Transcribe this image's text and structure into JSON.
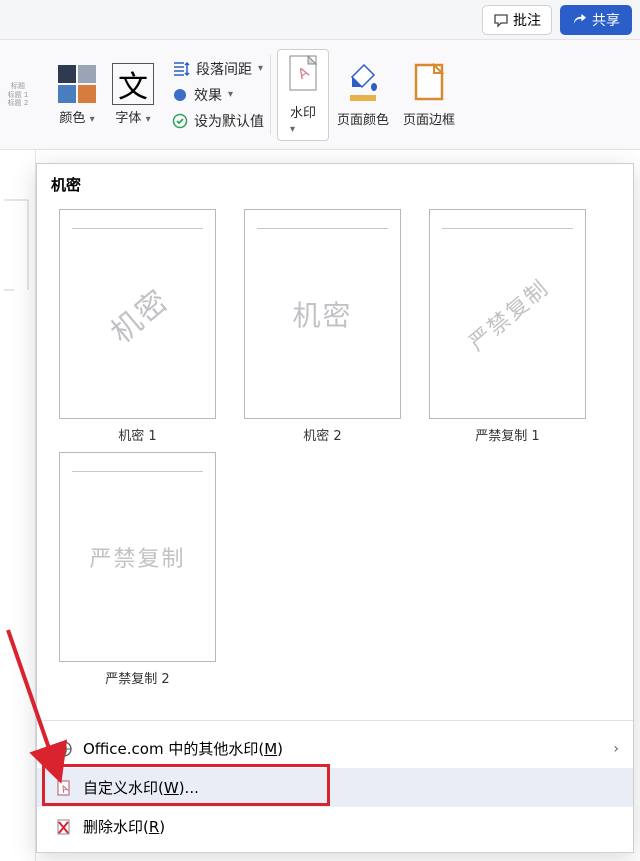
{
  "topbar": {
    "comment": "批注",
    "share": "共享"
  },
  "ribbon": {
    "color": "颜色",
    "font": "字体",
    "font_char": "文",
    "paragraph_spacing": "段落间距",
    "effects": "效果",
    "set_default": "设为默认值",
    "watermark": "水印",
    "page_color": "页面颜色",
    "page_border": "页面边框"
  },
  "dropdown": {
    "section": "机密",
    "thumbs": [
      {
        "wm": "机密",
        "label": "机密 1",
        "cls": "wm-diag"
      },
      {
        "wm": "机密",
        "label": "机密 2",
        "cls": "wm-horz"
      },
      {
        "wm": "严禁复制",
        "label": "严禁复制 1",
        "cls": "wm-diag wm-long"
      },
      {
        "wm": "严禁复制",
        "label": "严禁复制 2",
        "cls": "wm-horz wm-long"
      }
    ],
    "menu": {
      "office_more_pre": "Office.com 中的其他水印(",
      "office_more_key": "M",
      "office_more_post": ")",
      "custom_pre": "自定义水印(",
      "custom_key": "W",
      "custom_post": ")...",
      "remove_pre": "删除水印(",
      "remove_key": "R",
      "remove_post": ")"
    }
  }
}
